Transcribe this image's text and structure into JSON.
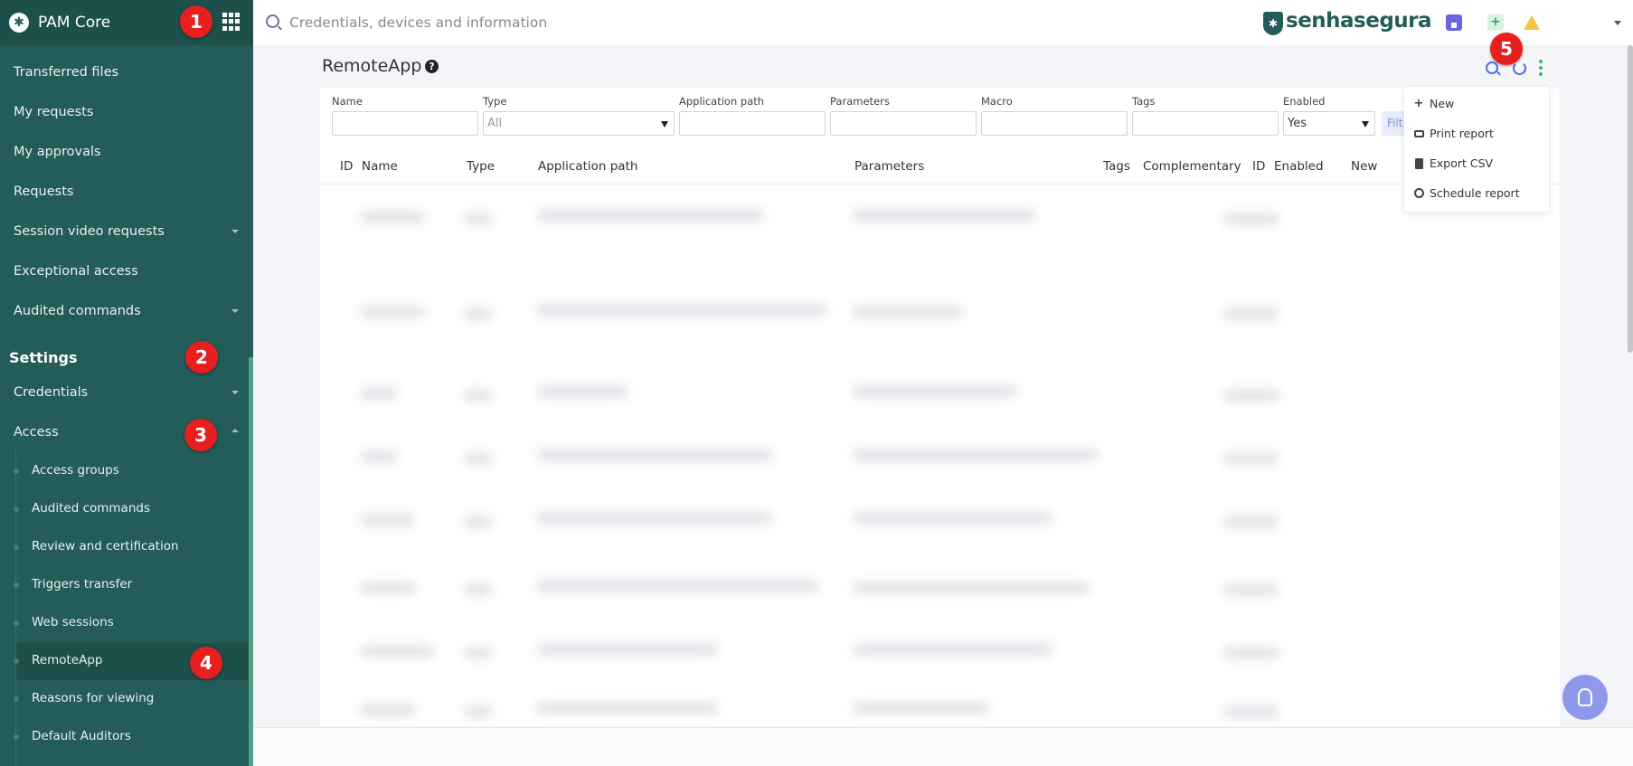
{
  "sidebar": {
    "brand": "PAM Core",
    "items": [
      {
        "label": "Transferred files",
        "caret": ""
      },
      {
        "label": "My requests",
        "caret": ""
      },
      {
        "label": "My approvals",
        "caret": ""
      },
      {
        "label": "Requests",
        "caret": ""
      },
      {
        "label": "Session video requests",
        "caret": "down"
      },
      {
        "label": "Exceptional access",
        "caret": ""
      },
      {
        "label": "Audited commands",
        "caret": "down"
      }
    ],
    "section_title": "Settings",
    "settings_items": [
      {
        "label": "Credentials",
        "caret": "down"
      },
      {
        "label": "Access",
        "caret": "up"
      }
    ],
    "access_subitems": [
      "Access groups",
      "Audited commands",
      "Review and certification",
      "Triggers transfer",
      "Web sessions",
      "RemoteApp",
      "Reasons for viewing",
      "Default Auditors"
    ],
    "active_subitem": "RemoteApp",
    "accent_color": "#235c58"
  },
  "topbar": {
    "search_placeholder": "Credentials, devices and information",
    "logo_text": "senhasegura",
    "icons": [
      "home-icon",
      "add-icon",
      "warning-icon",
      "chevron-down-icon"
    ]
  },
  "main": {
    "title": "RemoteApp",
    "filters": {
      "name_label": "Name",
      "type_label": "Type",
      "type_value": "All",
      "app_path_label": "Application path",
      "parameters_label": "Parameters",
      "macro_label": "Macro",
      "tags_label": "Tags",
      "enabled_label": "Enabled",
      "enabled_value": "Yes",
      "filter_button": "Filt"
    },
    "columns": [
      "ID",
      "Name",
      "Type",
      "Application path",
      "Parameters",
      "Tags",
      "Complementary",
      "ID",
      "Enabled",
      "New"
    ],
    "menu": {
      "new": "New",
      "print_report": "Print report",
      "export_csv": "Export CSV",
      "schedule_report": "Schedule report"
    }
  },
  "annotations": [
    "1",
    "2",
    "3",
    "4",
    "5"
  ]
}
